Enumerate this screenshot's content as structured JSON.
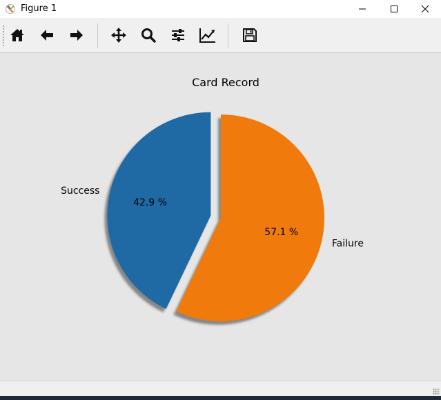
{
  "window": {
    "title": "Figure 1",
    "minimize_icon": "minimize-icon",
    "maximize_icon": "maximize-icon",
    "close_icon": "close-icon"
  },
  "toolbar": {
    "tools": [
      {
        "name": "home",
        "icon": "home-icon"
      },
      {
        "name": "back",
        "icon": "arrow-left-icon"
      },
      {
        "name": "forward",
        "icon": "arrow-right-icon"
      },
      {
        "name": "pan",
        "icon": "move-icon"
      },
      {
        "name": "zoom",
        "icon": "magnifier-icon"
      },
      {
        "name": "configure-subplots",
        "icon": "sliders-icon"
      },
      {
        "name": "edit-axes",
        "icon": "line-chart-icon"
      },
      {
        "name": "save",
        "icon": "floppy-disk-icon"
      }
    ]
  },
  "chart_data": {
    "type": "pie",
    "title": "Card Record",
    "labels": [
      "Success",
      "Failure"
    ],
    "values": [
      42.9,
      57.1
    ],
    "value_labels": [
      "42.9 %",
      "57.1 %"
    ],
    "colors": [
      "#1f6aa5",
      "#f07a0b"
    ],
    "explode": [
      0.1,
      0
    ],
    "shadow": true,
    "start_angle_deg": 90,
    "legend": "none"
  }
}
